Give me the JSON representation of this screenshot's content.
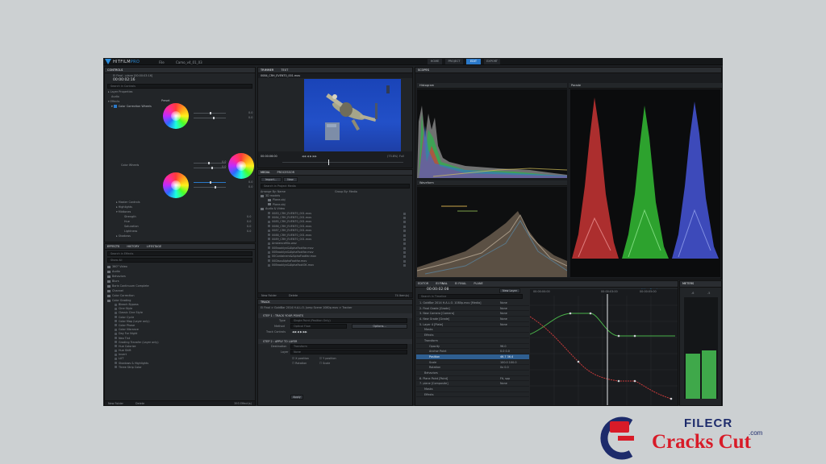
{
  "app": {
    "name_main": "HITFILM",
    "name_suffix": "PRO",
    "menu_file": "File",
    "project_name": "Camo_v4_01_03"
  },
  "workspaces": [
    "HOME",
    "PROJECT",
    "EDIT",
    "EXPORT"
  ],
  "controls": {
    "title": "CONTROLS",
    "clip": "EI Final - plane [00:00:03:16]",
    "timecode": "00:00:02:16",
    "search_placeholder": "Search in Controls",
    "tree": [
      "Layer Properties",
      "Audio",
      "Effects",
      "Color Correction Wheels"
    ],
    "preset_label": "Preset",
    "color_wheels_label": "Color Wheels",
    "values": [
      "0.0",
      "0.0",
      "0.0",
      "0.0",
      "0.0",
      "0.0"
    ],
    "sub": [
      "Master Controls",
      "Highlights",
      "Midtones"
    ],
    "midtone_rows": [
      {
        "label": "Strength",
        "value": "0.0"
      },
      {
        "label": "Hue",
        "value": "0.0"
      },
      {
        "label": "Saturation",
        "value": "0.0"
      },
      {
        "label": "Lightness",
        "value": "0.0"
      }
    ],
    "shadows": "Shadows"
  },
  "effects": {
    "tabs": [
      "EFFECTS",
      "HISTORY",
      "LIFESTAGE"
    ],
    "search_placeholder": "Search in Effects",
    "show": "Show All",
    "folders": [
      "360° Video",
      "Audio",
      "Behaviors",
      "Blurs",
      "Boris Continuum Complete",
      "Channel",
      "Color Correction",
      "Color Grading"
    ],
    "items": [
      "Bleach Bypass",
      "Cine Style",
      "Classic Cine Style",
      "Color Cycle",
      "Color Map (Layer only)",
      "Color Phase",
      "Color Vibrance",
      "Day For Night",
      "Neo Tint",
      "Grading Transfer (Layer only)",
      "Hue Colorize",
      "Hue Shift",
      "Invert",
      "LUT",
      "Shadows & Highlights",
      "Three Strip Color"
    ],
    "footer_new": "New Folder",
    "footer_delete": "Delete",
    "footer_count": "393 Effect(s)"
  },
  "viewer": {
    "tabs": [
      "TRIMMER",
      "TEXT"
    ],
    "clip": "0084_CRH_EVENT0_001.mov",
    "timecode": "00:00:06:00",
    "zoom": "(73.8%)",
    "full": "Full"
  },
  "media": {
    "tabs": [
      "MEDIA",
      "PROCESSOR"
    ],
    "import": "Import...",
    "new": "New",
    "search_placeholder": "Search in Project Media",
    "arrange": "Arrange By: Name",
    "group": "Group By: Media",
    "folders": [
      "3D models",
      "Plane.obj",
      "Plane.obj",
      "Audio & Video"
    ],
    "files": [
      "0083_CRH_EVENT0_001.mov",
      "0084_CRH_EVENT0_001.mov",
      "0085_CRH_EVENT0_001.mov",
      "0086_CRH_EVENT0_001.mov",
      "0087_CRH_EVENT0_001.mov",
      "0088_CRH_EVENT0_001.mov",
      "0089_CRH_EVENT0_001.mov",
      "AmbienceMix.wav",
      "00Brooklyn&AlphaFootfar.mov",
      "00Brooklyn&AlphaFootfar.mov",
      "00Containers&AlphaFootfar.mov",
      "00DiscoAlphaFootfar.mov",
      "00Brooklyn&AlphaFootOK.mov"
    ],
    "footer_new": "New Folder",
    "footer_delete": "Delete",
    "footer_count": "74 Item(s)"
  },
  "track": {
    "title": "TRACK",
    "path": "EI Final > GoldBar 2014 H.A.L.O. Jump Scene 1080p.mov > Tracker",
    "step1": "STEP 1 : TRACK YOUR POINTS",
    "type_label": "Type",
    "type_value": "Single Point (Position Only)",
    "method_label": "Method",
    "method_value": "Optical Flow",
    "options": "Options...",
    "controls_label": "Track Controls",
    "step2": "STEP 2 : APPLY TO LAYER",
    "dest_label": "Destination",
    "dest_value": "Transform",
    "layer_label": "Layer",
    "layer_value": "None",
    "checks": [
      "X position",
      "Y position",
      "Rotation",
      "Scale"
    ],
    "apply": "Apply"
  },
  "scopes": {
    "title": "SCOPES",
    "histogram": "Histogram",
    "waveform": "Waveform",
    "parade": "Parade"
  },
  "timeline": {
    "tabs": [
      "EDITOR",
      "EI FINAL",
      "EI FINAL",
      "PLANE"
    ],
    "timecode": "00:00:02:08",
    "new_layer": "New Layer",
    "value_graph": "Value Graph",
    "search_placeholder": "Search in Timeline",
    "ruler": [
      "00:00:00:00",
      "00:00:03:00",
      "00:00:05:00"
    ],
    "layers": [
      {
        "label": "1. GoldBar 2014 H.A.L.O. 1080p.mov [Media]",
        "blend": "None"
      },
      {
        "label": "2. Final Grade [Grade]",
        "blend": "None"
      },
      {
        "label": "3. New Camera [Camera]",
        "blend": "None"
      },
      {
        "label": "4. New Grade [Grade]",
        "blend": "None"
      },
      {
        "label": "5. Layer 4 [Plate]",
        "blend": "None"
      },
      {
        "label": "Masks",
        "blend": ""
      },
      {
        "label": "Effects",
        "blend": ""
      },
      {
        "label": "Transform",
        "blend": ""
      },
      {
        "label": "Opacity",
        "blend": "96.0"
      },
      {
        "label": "Anchor Point",
        "blend": "0.0    0.0"
      },
      {
        "label": "Position",
        "blend": "46.7   36.4"
      },
      {
        "label": "Scale",
        "blend": "100.0  100.0"
      },
      {
        "label": "Rotation",
        "blend": "0x    0.0"
      },
      {
        "label": "Behaviors",
        "blend": ""
      },
      {
        "label": "6. Plane Point [Point]",
        "blend": "Fit, spp"
      },
      {
        "label": "7. plane [Composite]",
        "blend": "None"
      },
      {
        "label": "Masks",
        "blend": ""
      },
      {
        "label": "Effects",
        "blend": ""
      }
    ]
  },
  "meters": {
    "title": "METERS",
    "left": "-6",
    "right": "-5"
  },
  "watermark": {
    "filecr": "FILECR",
    "site": "Cracks Cut",
    "dotcom": ".com"
  },
  "colors": {
    "accent": "#2a78c8",
    "brand_red": "#d81b28",
    "brand_navy": "#1d2b6b"
  }
}
